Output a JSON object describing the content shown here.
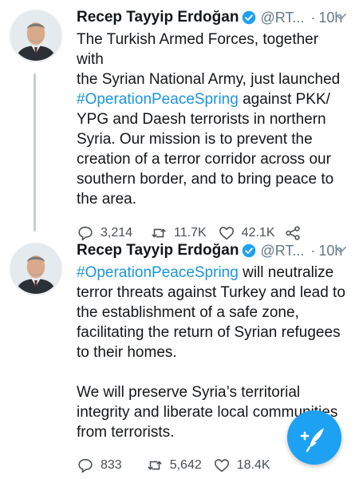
{
  "tweets": [
    {
      "author_name": "Recep Tayyip Erdoğan",
      "handle": "@RT...",
      "separator": "·",
      "time": "10h",
      "text_lines": [
        {
          "before": "",
          "hashtag": "",
          "after": "The Turkish Armed Forces, together with"
        },
        {
          "before": "",
          "hashtag": "",
          "after": "the Syrian National Army, just launched"
        },
        {
          "before": "",
          "hashtag": "#OperationPeaceSpring",
          "after": " against PKK/"
        },
        {
          "before": "",
          "hashtag": "",
          "after": "YPG and Daesh terrorists in northern"
        },
        {
          "before": "",
          "hashtag": "",
          "after": "Syria. Our mission is to prevent the"
        },
        {
          "before": "",
          "hashtag": "",
          "after": "creation of a terror corridor across our"
        },
        {
          "before": "",
          "hashtag": "",
          "after": "southern border, and to bring peace to"
        },
        {
          "before": "",
          "hashtag": "",
          "after": "the area."
        }
      ],
      "replies": "3,214",
      "retweets": "11.7K",
      "likes": "42.1K"
    },
    {
      "author_name": "Recep Tayyip Erdoğan",
      "handle": "@RT...",
      "separator": "·",
      "time": "10h",
      "text_lines": [
        {
          "before": "",
          "hashtag": "#OperationPeaceSpring",
          "after": " will neutralize"
        },
        {
          "before": "",
          "hashtag": "",
          "after": "terror threats against Turkey and lead to"
        },
        {
          "before": "",
          "hashtag": "",
          "after": "the establishment of a safe zone,"
        },
        {
          "before": "",
          "hashtag": "",
          "after": "facilitating the return of Syrian refugees"
        },
        {
          "before": "",
          "hashtag": "",
          "after": "to their homes."
        },
        {
          "before": "",
          "hashtag": "",
          "after": ""
        },
        {
          "before": "",
          "hashtag": "",
          "after": "We will preserve Syria’s territorial"
        },
        {
          "before": "",
          "hashtag": "",
          "after": "integrity and liberate local communities"
        },
        {
          "before": "",
          "hashtag": "",
          "after": "from terrorists."
        }
      ],
      "replies": "833",
      "retweets": "5,642",
      "likes": "18.4K"
    }
  ],
  "colors": {
    "hashtag": "#1b95e0",
    "verified_badge": "#1da1f2",
    "fab_background": "#1da1f2",
    "secondary_text": "#657786"
  },
  "icons": {
    "reply": "reply-icon",
    "retweet": "retweet-icon",
    "like": "heart-icon",
    "share": "share-icon",
    "verified": "verified-badge-icon",
    "more": "chevron-down-icon",
    "compose": "compose-tweet-icon"
  }
}
